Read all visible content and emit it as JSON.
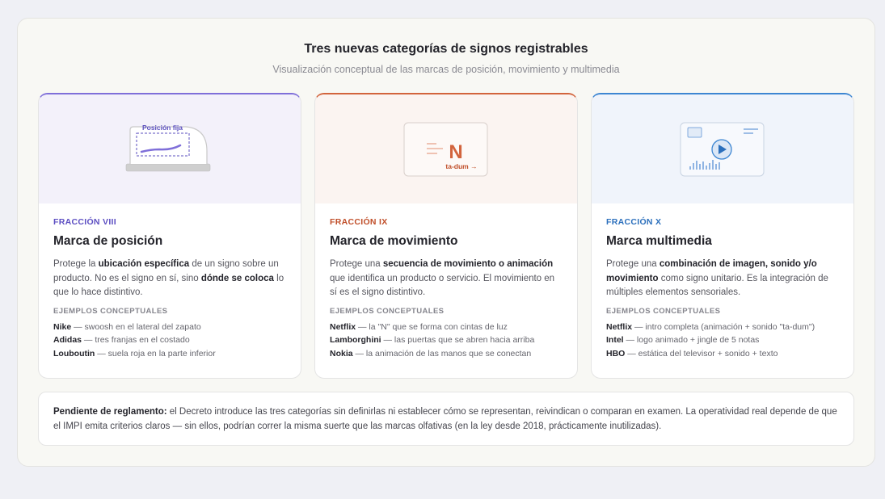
{
  "title": "Tres nuevas categorías de signos registrables",
  "subtitle": "Visualización conceptual de las marcas de posición, movimiento y multimedia",
  "examples_heading": "EJEMPLOS CONCEPTUALES",
  "cards": [
    {
      "fraction": "FRACCIÓN VIII",
      "name": "Marca de posición",
      "accent": "#7f6fd9",
      "illustration": {
        "label": "Posición fija"
      },
      "desc": [
        {
          "t": "Protege la ",
          "b": false
        },
        {
          "t": "ubicación específica",
          "b": true
        },
        {
          "t": " de un signo sobre un producto. No es el signo en sí, sino ",
          "b": false
        },
        {
          "t": "dónde se coloca",
          "b": true
        },
        {
          "t": " lo que lo hace distintivo.",
          "b": false
        }
      ],
      "examples": [
        {
          "brand": "Nike",
          "text": " — swoosh en el lateral del zapato"
        },
        {
          "brand": "Adidas",
          "text": " — tres franjas en el costado"
        },
        {
          "brand": "Louboutin",
          "text": " — suela roja en la parte inferior"
        }
      ]
    },
    {
      "fraction": "FRACCIÓN IX",
      "name": "Marca de movimiento",
      "accent": "#d2643d",
      "illustration": {
        "letter": "N",
        "sound": "ta-dum →"
      },
      "desc": [
        {
          "t": "Protege una ",
          "b": false
        },
        {
          "t": "secuencia de movimiento o animación",
          "b": true
        },
        {
          "t": " que identifica un producto o servicio. El movimiento en sí es el signo distintivo.",
          "b": false
        }
      ],
      "examples": [
        {
          "brand": "Netflix",
          "text": " — la \"N\" que se forma con cintas de luz"
        },
        {
          "brand": "Lamborghini",
          "text": " — las puertas que se abren hacia arriba"
        },
        {
          "brand": "Nokia",
          "text": " — la animación de las manos que se conectan"
        }
      ]
    },
    {
      "fraction": "FRACCIÓN X",
      "name": "Marca multimedia",
      "accent": "#3d86d2",
      "illustration": {},
      "desc": [
        {
          "t": "Protege una ",
          "b": false
        },
        {
          "t": "combinación de imagen, sonido y/o movimiento",
          "b": true
        },
        {
          "t": " como signo unitario. Es la integración de múltiples elementos sensoriales.",
          "b": false
        }
      ],
      "examples": [
        {
          "brand": "Netflix",
          "text": " — intro completa (animación + sonido \"ta-dum\")"
        },
        {
          "brand": "Intel",
          "text": " — logo animado + jingle de 5 notas"
        },
        {
          "brand": "HBO",
          "text": " — estática del televisor + sonido + texto"
        }
      ]
    }
  ],
  "note": {
    "label": "Pendiente de reglamento:",
    "text": " el Decreto introduce las tres categorías sin definirlas ni establecer cómo se representan, reivindican o comparan en examen. La operatividad real depende de que el IMPI emita criterios claros — sin ellos, podrían correr la misma suerte que las marcas olfativas (en la ley desde 2018, prácticamente inutilizadas)."
  }
}
